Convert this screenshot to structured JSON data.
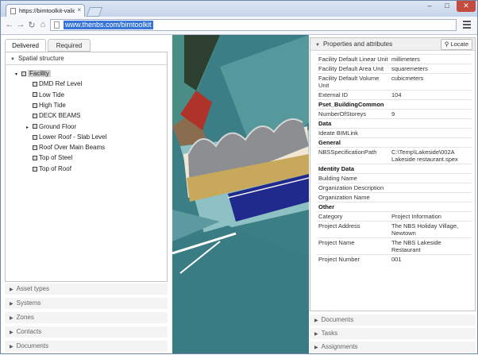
{
  "browser": {
    "tab_title": "https://bimtoolkit-validat",
    "close_glyph": "×",
    "url": "www.thenbs.com/bimtoolkit",
    "window_controls": {
      "min": "–",
      "max": "□",
      "close": "✕"
    },
    "nav": {
      "back": "←",
      "forward": "→",
      "reload": "↻",
      "home": "⌂"
    }
  },
  "left_panel": {
    "tabs": [
      {
        "label": "Delivered"
      },
      {
        "label": "Required"
      }
    ],
    "spatial_header": "Spatial structure",
    "tree": [
      {
        "label": "Facility",
        "level": 0,
        "selected": true
      },
      {
        "label": "DMD Ref Level",
        "level": 1
      },
      {
        "label": "Low Tide",
        "level": 1
      },
      {
        "label": "High Tide",
        "level": 1
      },
      {
        "label": "DECK BEAMS",
        "level": 1
      },
      {
        "label": "Ground Floor",
        "level": 1,
        "expandable": true
      },
      {
        "label": "Lower Roof - Slab Level",
        "level": 1
      },
      {
        "label": "Roof Over Main Beams",
        "level": 1
      },
      {
        "label": "Top of Steel",
        "level": 1
      },
      {
        "label": "Top of Roof",
        "level": 1
      }
    ],
    "accordions": [
      {
        "label": "Asset types"
      },
      {
        "label": "Systems"
      },
      {
        "label": "Zones"
      },
      {
        "label": "Contacts"
      },
      {
        "label": "Documents"
      }
    ]
  },
  "right_panel": {
    "header": "Properties and attributes",
    "locate_label": "Locate",
    "rows": [
      {
        "type": "kv",
        "key": "Facility Default Linear Unit",
        "value": "millimeters"
      },
      {
        "type": "kv",
        "key": "Facility Default Area Unit",
        "value": "squaremeters"
      },
      {
        "type": "kv",
        "key": "Facility Default Volume Unit",
        "value": "cubicmeters"
      },
      {
        "type": "kv",
        "key": "External ID",
        "value": "104"
      },
      {
        "type": "group",
        "key": "Pset_BuildingCommon"
      },
      {
        "type": "kv",
        "key": "NumberOfStoreys",
        "value": "9"
      },
      {
        "type": "group",
        "key": "Data"
      },
      {
        "type": "kv",
        "key": "Ideate BIMLink",
        "value": ""
      },
      {
        "type": "group",
        "key": "General"
      },
      {
        "type": "kv",
        "key": "NBSSpecificationPath",
        "value": "C:\\Temp\\Lakeside\\002A Lakeside restaurant.spex"
      },
      {
        "type": "group",
        "key": "Identity Data"
      },
      {
        "type": "kv",
        "key": "Building Name",
        "value": ""
      },
      {
        "type": "kv",
        "key": "Organization Description",
        "value": ""
      },
      {
        "type": "kv",
        "key": "Organization Name",
        "value": ""
      },
      {
        "type": "group",
        "key": "Other"
      },
      {
        "type": "kv",
        "key": "Category",
        "value": "Project Information"
      },
      {
        "type": "kv",
        "key": "Project Address",
        "value": "The NBS Holiday Village, Newtown"
      },
      {
        "type": "kv",
        "key": "Project Name",
        "value": "The NBS Lakeside Restaurant"
      },
      {
        "type": "kv",
        "key": "Project Number",
        "value": "001"
      }
    ],
    "accordions": [
      {
        "label": "Documents"
      },
      {
        "label": "Tasks"
      },
      {
        "label": "Assignments"
      }
    ]
  }
}
